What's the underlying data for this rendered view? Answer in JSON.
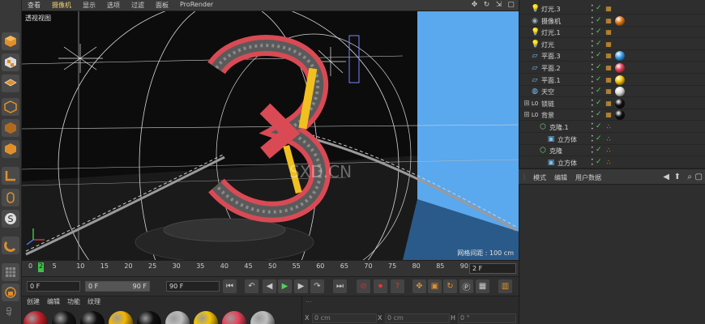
{
  "viewport_menu": {
    "items": [
      {
        "label": "查看",
        "highlight": false
      },
      {
        "label": "摄像机",
        "highlight": true
      },
      {
        "label": "显示",
        "highlight": false
      },
      {
        "label": "选项",
        "highlight": false
      },
      {
        "label": "过滤",
        "highlight": false
      },
      {
        "label": "面板",
        "highlight": false
      },
      {
        "label": "ProRender",
        "highlight": false
      }
    ]
  },
  "viewport": {
    "label": "透视视图",
    "grid_info": "网格间距 : 100 cm",
    "watermark": "唯艺创 · 课程作 · SXD.CN"
  },
  "timeline": {
    "ticks": [
      "0",
      "5",
      "10",
      "15",
      "20",
      "25",
      "30",
      "35",
      "40",
      "45",
      "50",
      "55",
      "60",
      "65",
      "70",
      "75",
      "80",
      "85",
      "90"
    ],
    "current_marker": "2",
    "frame_value": "2 F"
  },
  "controls": {
    "start_field": "0 F",
    "range_start": "0 F",
    "range_end": "90 F",
    "end_field": "90 F"
  },
  "material_bar": {
    "tabs": [
      "创建",
      "编辑",
      "功能",
      "纹理"
    ],
    "side_label": "4D",
    "balls": [
      "#c0202a",
      "#161616",
      "#101010",
      "#f5b800",
      "#101010",
      "#bcbcbc",
      "#f5c400",
      "#e8435a",
      "#bfbfbf"
    ]
  },
  "coord_bar": {
    "x_label": "X",
    "x_value": "0 cm",
    "x2_label": "X",
    "x2_value": "0 cm",
    "h_label": "H",
    "h_value": "0 °"
  },
  "object_manager": {
    "objects": [
      {
        "name": "灯光.3",
        "icon": "light-icon",
        "indent": 0,
        "tag": ""
      },
      {
        "name": "摄像机",
        "icon": "camera-icon",
        "indent": 0,
        "tag": "#e07a1a"
      },
      {
        "name": "灯光.1",
        "icon": "light-icon",
        "indent": 0,
        "tag": ""
      },
      {
        "name": "灯光",
        "icon": "light-icon",
        "indent": 0,
        "tag": ""
      },
      {
        "name": "平面.3",
        "icon": "plane-icon",
        "indent": 0,
        "tag": "#3aa0f0"
      },
      {
        "name": "平面.2",
        "icon": "plane-icon",
        "indent": 0,
        "tag": "#e8435a"
      },
      {
        "name": "平面.1",
        "icon": "plane-icon",
        "indent": 0,
        "tag": "#f5c400"
      },
      {
        "name": "天空",
        "icon": "sky-icon",
        "indent": 0,
        "tag": "#dddddd"
      },
      {
        "name": "锁链",
        "icon": "null-icon",
        "indent": 0,
        "tag": "#111111"
      },
      {
        "name": "背景",
        "icon": "null-icon",
        "indent": 0,
        "tag": "#111111"
      },
      {
        "name": "克隆.1",
        "icon": "cloner-icon",
        "indent": 1,
        "tag": ""
      },
      {
        "name": "立方体",
        "icon": "cube-icon",
        "indent": 2,
        "tag": ""
      },
      {
        "name": "克隆",
        "icon": "cloner-icon",
        "indent": 1,
        "tag": ""
      },
      {
        "name": "立方体",
        "icon": "cube-icon",
        "indent": 2,
        "tag": ""
      }
    ]
  },
  "attributes": {
    "menu": [
      "模式",
      "编辑",
      "用户数据"
    ]
  }
}
